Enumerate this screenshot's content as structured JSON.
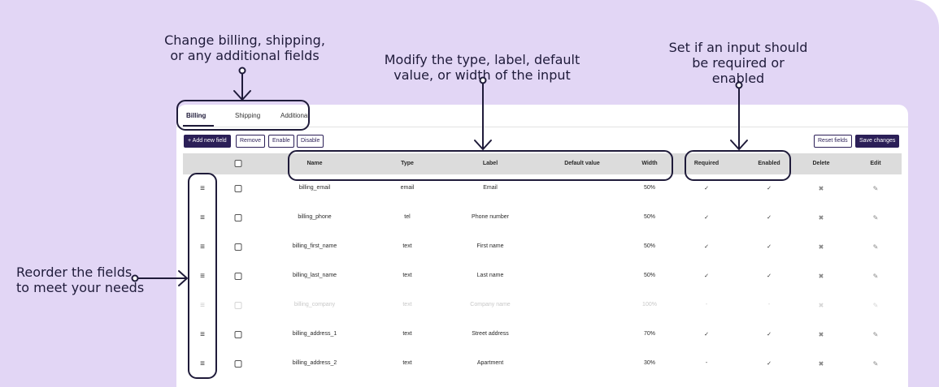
{
  "annotations": {
    "fields_line1": "Change billing, shipping,",
    "fields_line2": "or any additional fields",
    "modify_line1": "Modify the type, label, default",
    "modify_line2": "value, or width of the input",
    "required_line1": "Set if an input should",
    "required_line2": "be required or",
    "required_line3": "enabled",
    "reorder_line1": "Reorder the fields",
    "reorder_line2": "to meet your needs"
  },
  "tabs": [
    {
      "label": "Billing",
      "active": true
    },
    {
      "label": "Shipping",
      "active": false
    },
    {
      "label": "Additional",
      "active": false
    }
  ],
  "toolbar": {
    "add_label": "+ Add new field",
    "remove_label": "Remove",
    "enable_label": "Enable",
    "disable_label": "Disable",
    "reset_label": "Reset fields",
    "save_label": "Save changes"
  },
  "table": {
    "headers": {
      "name": "Name",
      "type": "Type",
      "label": "Label",
      "default_value": "Default value",
      "width": "Width",
      "required": "Required",
      "enabled": "Enabled",
      "delete": "Delete",
      "edit": "Edit"
    },
    "rows": [
      {
        "name": "billing_email",
        "type": "email",
        "label": "Email",
        "default": "",
        "width": "50%",
        "required": "✓",
        "enabled": "✓",
        "disabled": false
      },
      {
        "name": "billing_phone",
        "type": "tel",
        "label": "Phone number",
        "default": "",
        "width": "50%",
        "required": "✓",
        "enabled": "✓",
        "disabled": false
      },
      {
        "name": "billing_first_name",
        "type": "text",
        "label": "First name",
        "default": "",
        "width": "50%",
        "required": "✓",
        "enabled": "✓",
        "disabled": false
      },
      {
        "name": "billing_last_name",
        "type": "text",
        "label": "Last name",
        "default": "",
        "width": "50%",
        "required": "✓",
        "enabled": "✓",
        "disabled": false
      },
      {
        "name": "billing_company",
        "type": "text",
        "label": "Company name",
        "default": "",
        "width": "100%",
        "required": "-",
        "enabled": "-",
        "disabled": true
      },
      {
        "name": "billing_address_1",
        "type": "text",
        "label": "Street address",
        "default": "",
        "width": "70%",
        "required": "✓",
        "enabled": "✓",
        "disabled": false
      },
      {
        "name": "billing_address_2",
        "type": "text",
        "label": "Apartment",
        "default": "",
        "width": "30%",
        "required": "-",
        "enabled": "✓",
        "disabled": false
      }
    ],
    "drag_icon": "≡",
    "delete_icon": "✖",
    "edit_icon": "✎"
  },
  "colors": {
    "background": "#e2d6f5",
    "accent": "#2b1f57",
    "header_bg": "#dcdcdc"
  }
}
